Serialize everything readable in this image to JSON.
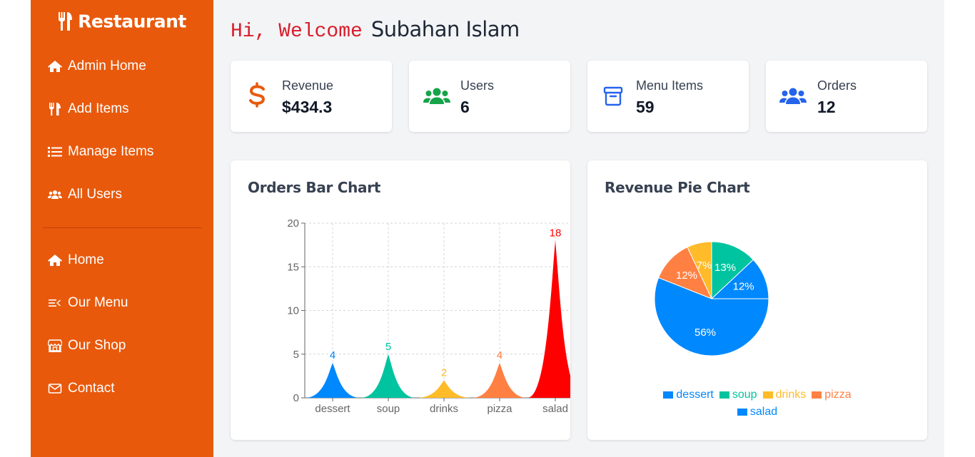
{
  "brand": {
    "name": "Restaurant",
    "icon": "utensils-icon"
  },
  "sidebar": {
    "admin_items": [
      {
        "label": "Admin Home",
        "icon": "house-icon"
      },
      {
        "label": "Add Items",
        "icon": "utensils-icon"
      },
      {
        "label": "Manage Items",
        "icon": "list-icon"
      },
      {
        "label": "All Users",
        "icon": "users-icon"
      }
    ],
    "site_items": [
      {
        "label": "Home",
        "icon": "house-icon"
      },
      {
        "label": "Our Menu",
        "icon": "menu-icon"
      },
      {
        "label": "Our Shop",
        "icon": "shop-icon"
      },
      {
        "label": "Contact",
        "icon": "envelope-icon"
      }
    ]
  },
  "greeting": {
    "prefix": "Hi, Welcome",
    "name": "Subahan Islam"
  },
  "stats": [
    {
      "label": "Revenue",
      "value": "$434.3",
      "icon": "dollar-icon",
      "color": "#e8590c"
    },
    {
      "label": "Users",
      "value": "6",
      "icon": "users-icon",
      "color": "#16a34a"
    },
    {
      "label": "Menu Items",
      "value": "59",
      "icon": "archive-box-icon",
      "color": "#2563eb"
    },
    {
      "label": "Orders",
      "value": "12",
      "icon": "users-icon",
      "color": "#2563eb"
    }
  ],
  "bar_panel": {
    "title": "Orders Bar Chart"
  },
  "pie_panel": {
    "title": "Revenue Pie Chart"
  },
  "chart_data": [
    {
      "type": "bar",
      "categories": [
        "dessert",
        "soup",
        "drinks",
        "pizza",
        "salad"
      ],
      "values": [
        4,
        5,
        2,
        4,
        18
      ],
      "colors": [
        "#0088fe",
        "#00c49f",
        "#ffbb28",
        "#ff8042",
        "#ff0000"
      ],
      "ylim": [
        0,
        20
      ],
      "yticks": [
        0,
        5,
        10,
        15,
        20
      ],
      "grid": true
    },
    {
      "type": "pie",
      "labels": [
        "dessert",
        "soup",
        "drinks",
        "pizza",
        "salad"
      ],
      "percent_labels": [
        "12%",
        "13%",
        "7%",
        "12%",
        "56%"
      ],
      "values": [
        12,
        13,
        7,
        12,
        56
      ],
      "colors": [
        "#0088fe",
        "#00c49f",
        "#ffbb28",
        "#ff8042",
        "#0088fe"
      ],
      "legend_position": "bottom"
    }
  ]
}
